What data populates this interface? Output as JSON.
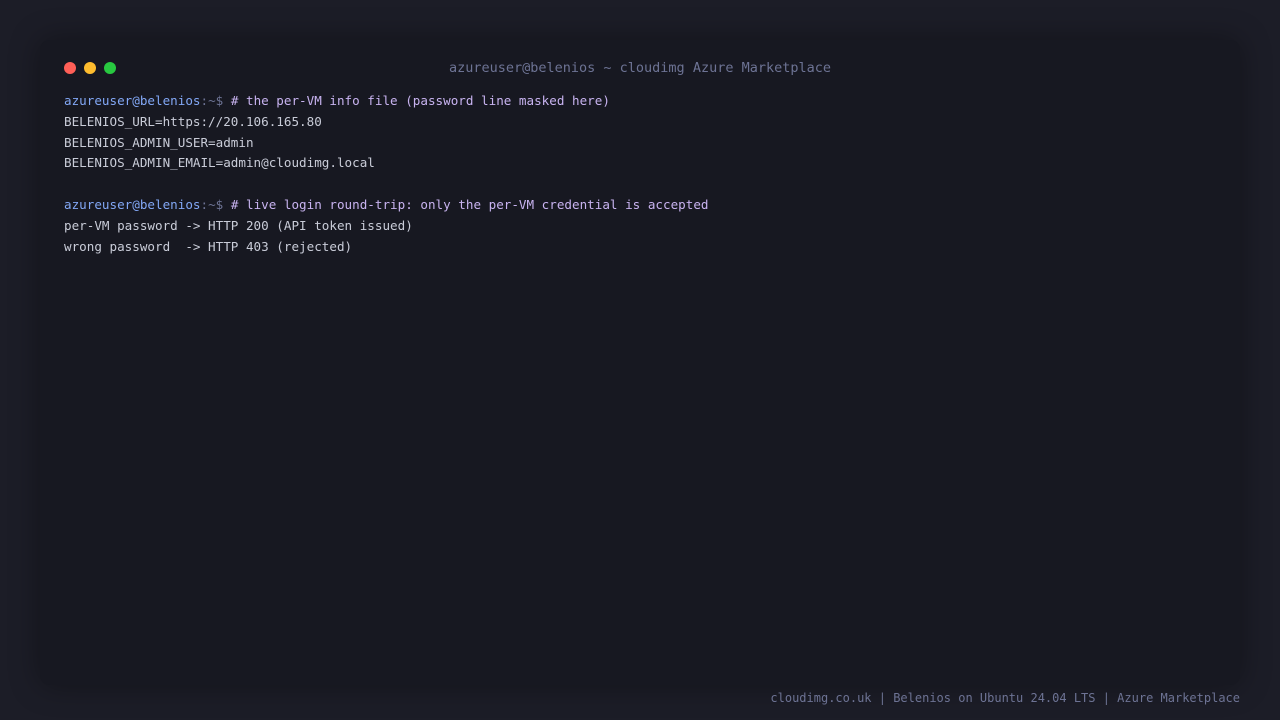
{
  "window": {
    "title": "azureuser@belenios ~ cloudimg Azure Marketplace"
  },
  "prompt": {
    "user_host": "azureuser@belenios",
    "path_suffix": ":~$"
  },
  "blocks": [
    {
      "command": " # the per-VM info file (password line masked here)",
      "output": [
        "BELENIOS_URL=https://20.106.165.80",
        "BELENIOS_ADMIN_USER=admin",
        "BELENIOS_ADMIN_EMAIL=admin@cloudimg.local"
      ]
    },
    {
      "command": " # live login round-trip: only the per-VM credential is accepted",
      "output": [
        "per-VM password -> HTTP 200 (API token issued)",
        "wrong password  -> HTTP 403 (rejected)"
      ]
    }
  ],
  "footer": {
    "text": "cloudimg.co.uk | Belenios on Ubuntu 24.04 LTS | Azure Marketplace"
  },
  "colors": {
    "background": "#1c1d27",
    "terminal": "#171821",
    "prompt_user": "#82a7f5",
    "command": "#c8b3f0",
    "output": "#c9ccd8",
    "muted": "#6d7394",
    "close": "#ff5f57",
    "minimize": "#febc2e",
    "maximize": "#28c840"
  }
}
